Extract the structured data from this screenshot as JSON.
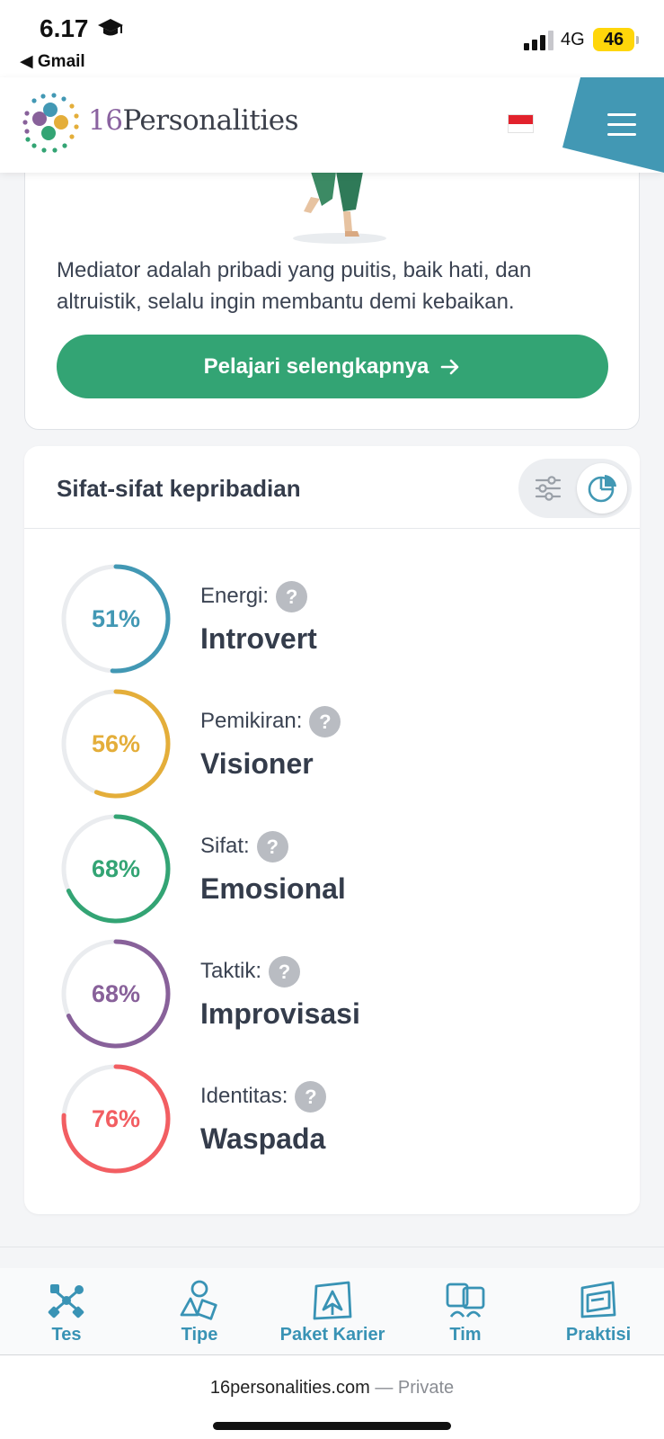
{
  "status_bar": {
    "time": "6.17",
    "back_app": "◀ Gmail",
    "network": "4G",
    "battery": "46"
  },
  "header": {
    "logo_number": "16",
    "logo_word": "Personalities",
    "colors": {
      "brand_teal": "#4298b4",
      "menu_bg": "#4298b4"
    }
  },
  "intro": {
    "description": "Mediator adalah pribadi yang puitis, baik hati, dan altruistik, selalu ingin membantu demi kebaikan.",
    "cta_label": "Pelajari selengkapnya"
  },
  "traits_section": {
    "title": "Sifat-sifat kepribadian",
    "view_toggle": {
      "options": [
        "sliders-icon",
        "pie-chart-icon"
      ],
      "selected": "pie-chart-icon"
    },
    "traits": [
      {
        "label": "Energi:",
        "value": "Introvert",
        "percent": 51,
        "percent_text": "51%",
        "color": "#4298b4"
      },
      {
        "label": "Pemikiran:",
        "value": "Visioner",
        "percent": 56,
        "percent_text": "56%",
        "color": "#e4ae3a"
      },
      {
        "label": "Sifat:",
        "value": "Emosional",
        "percent": 68,
        "percent_text": "68%",
        "color": "#33a474"
      },
      {
        "label": "Taktik:",
        "value": "Improvisasi",
        "percent": 68,
        "percent_text": "68%",
        "color": "#88619a"
      },
      {
        "label": "Identitas:",
        "value": "Waspada",
        "percent": 76,
        "percent_text": "76%",
        "color": "#f25e62"
      }
    ],
    "help_glyph": "?"
  },
  "bottom_nav": [
    {
      "label": "Tes",
      "icon": "test-icon"
    },
    {
      "label": "Tipe",
      "icon": "types-icon"
    },
    {
      "label": "Paket Karier",
      "icon": "career-icon"
    },
    {
      "label": "Tim",
      "icon": "team-icon"
    },
    {
      "label": "Praktisi",
      "icon": "practitioner-icon"
    }
  ],
  "url_bar": {
    "domain": "16personalities.com",
    "separator": "—",
    "mode": "Private"
  }
}
